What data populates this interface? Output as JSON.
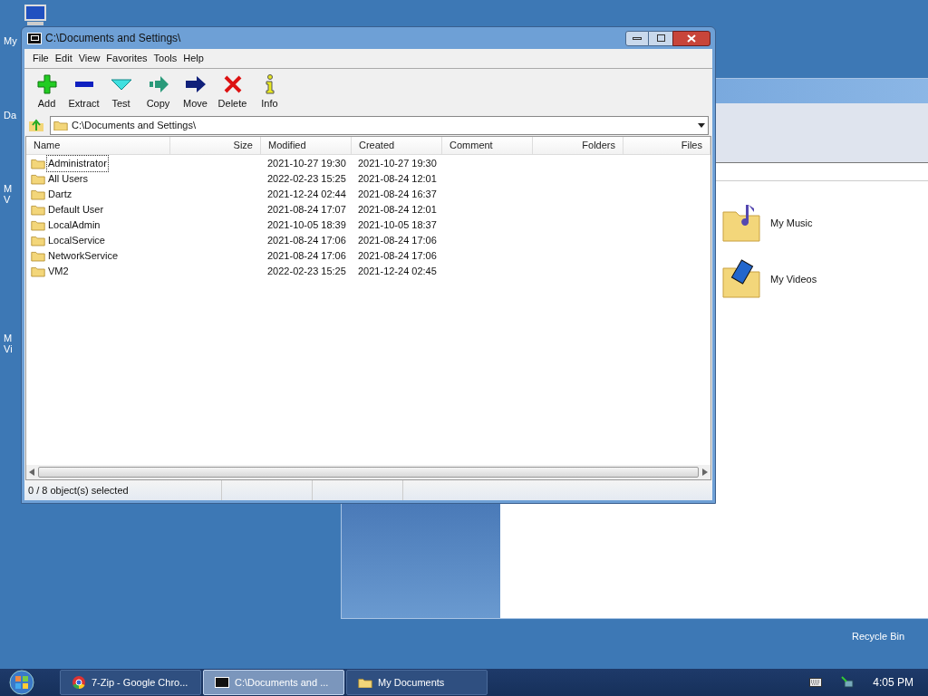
{
  "desktop_icons": [
    {
      "lines": [
        "My"
      ]
    },
    {
      "lines": [
        "Da"
      ]
    },
    {
      "lines": [
        "M",
        "V"
      ]
    },
    {
      "lines": [
        "M",
        "Vi"
      ]
    },
    {
      "lines": [
        "Recycle Bin"
      ]
    }
  ],
  "background_window": {
    "items": [
      {
        "label": "My Music"
      },
      {
        "label": "My Videos"
      }
    ]
  },
  "window": {
    "title": "C:\\Documents and Settings\\",
    "menu": [
      "File",
      "Edit",
      "View",
      "Favorites",
      "Tools",
      "Help"
    ],
    "toolbar": [
      "Add",
      "Extract",
      "Test",
      "Copy",
      "Move",
      "Delete",
      "Info"
    ],
    "address": "C:\\Documents and Settings\\",
    "columns": [
      "Name",
      "Size",
      "Modified",
      "Created",
      "Comment",
      "Folders",
      "Files"
    ],
    "rows": [
      {
        "name": "Administrator",
        "modified": "2021-10-27 19:30",
        "created": "2021-10-27 19:30",
        "focused": true
      },
      {
        "name": "All Users",
        "modified": "2022-02-23 15:25",
        "created": "2021-08-24 12:01",
        "focused": false
      },
      {
        "name": "Dartz",
        "modified": "2021-12-24 02:44",
        "created": "2021-08-24 16:37",
        "focused": false
      },
      {
        "name": "Default User",
        "modified": "2021-08-24 17:07",
        "created": "2021-08-24 12:01",
        "focused": false
      },
      {
        "name": "LocalAdmin",
        "modified": "2021-10-05 18:39",
        "created": "2021-10-05 18:37",
        "focused": false
      },
      {
        "name": "LocalService",
        "modified": "2021-08-24 17:06",
        "created": "2021-08-24 17:06",
        "focused": false
      },
      {
        "name": "NetworkService",
        "modified": "2021-08-24 17:06",
        "created": "2021-08-24 17:06",
        "focused": false
      },
      {
        "name": "VM2",
        "modified": "2022-02-23 15:25",
        "created": "2021-12-24 02:45",
        "focused": false
      }
    ],
    "status": "0 / 8 object(s) selected"
  },
  "taskbar": {
    "buttons": [
      {
        "label": "7-Zip - Google Chro...",
        "selected": false
      },
      {
        "label": "C:\\Documents and ...",
        "selected": true
      },
      {
        "label": "My Documents",
        "selected": false
      }
    ],
    "clock": "4:05 PM"
  }
}
